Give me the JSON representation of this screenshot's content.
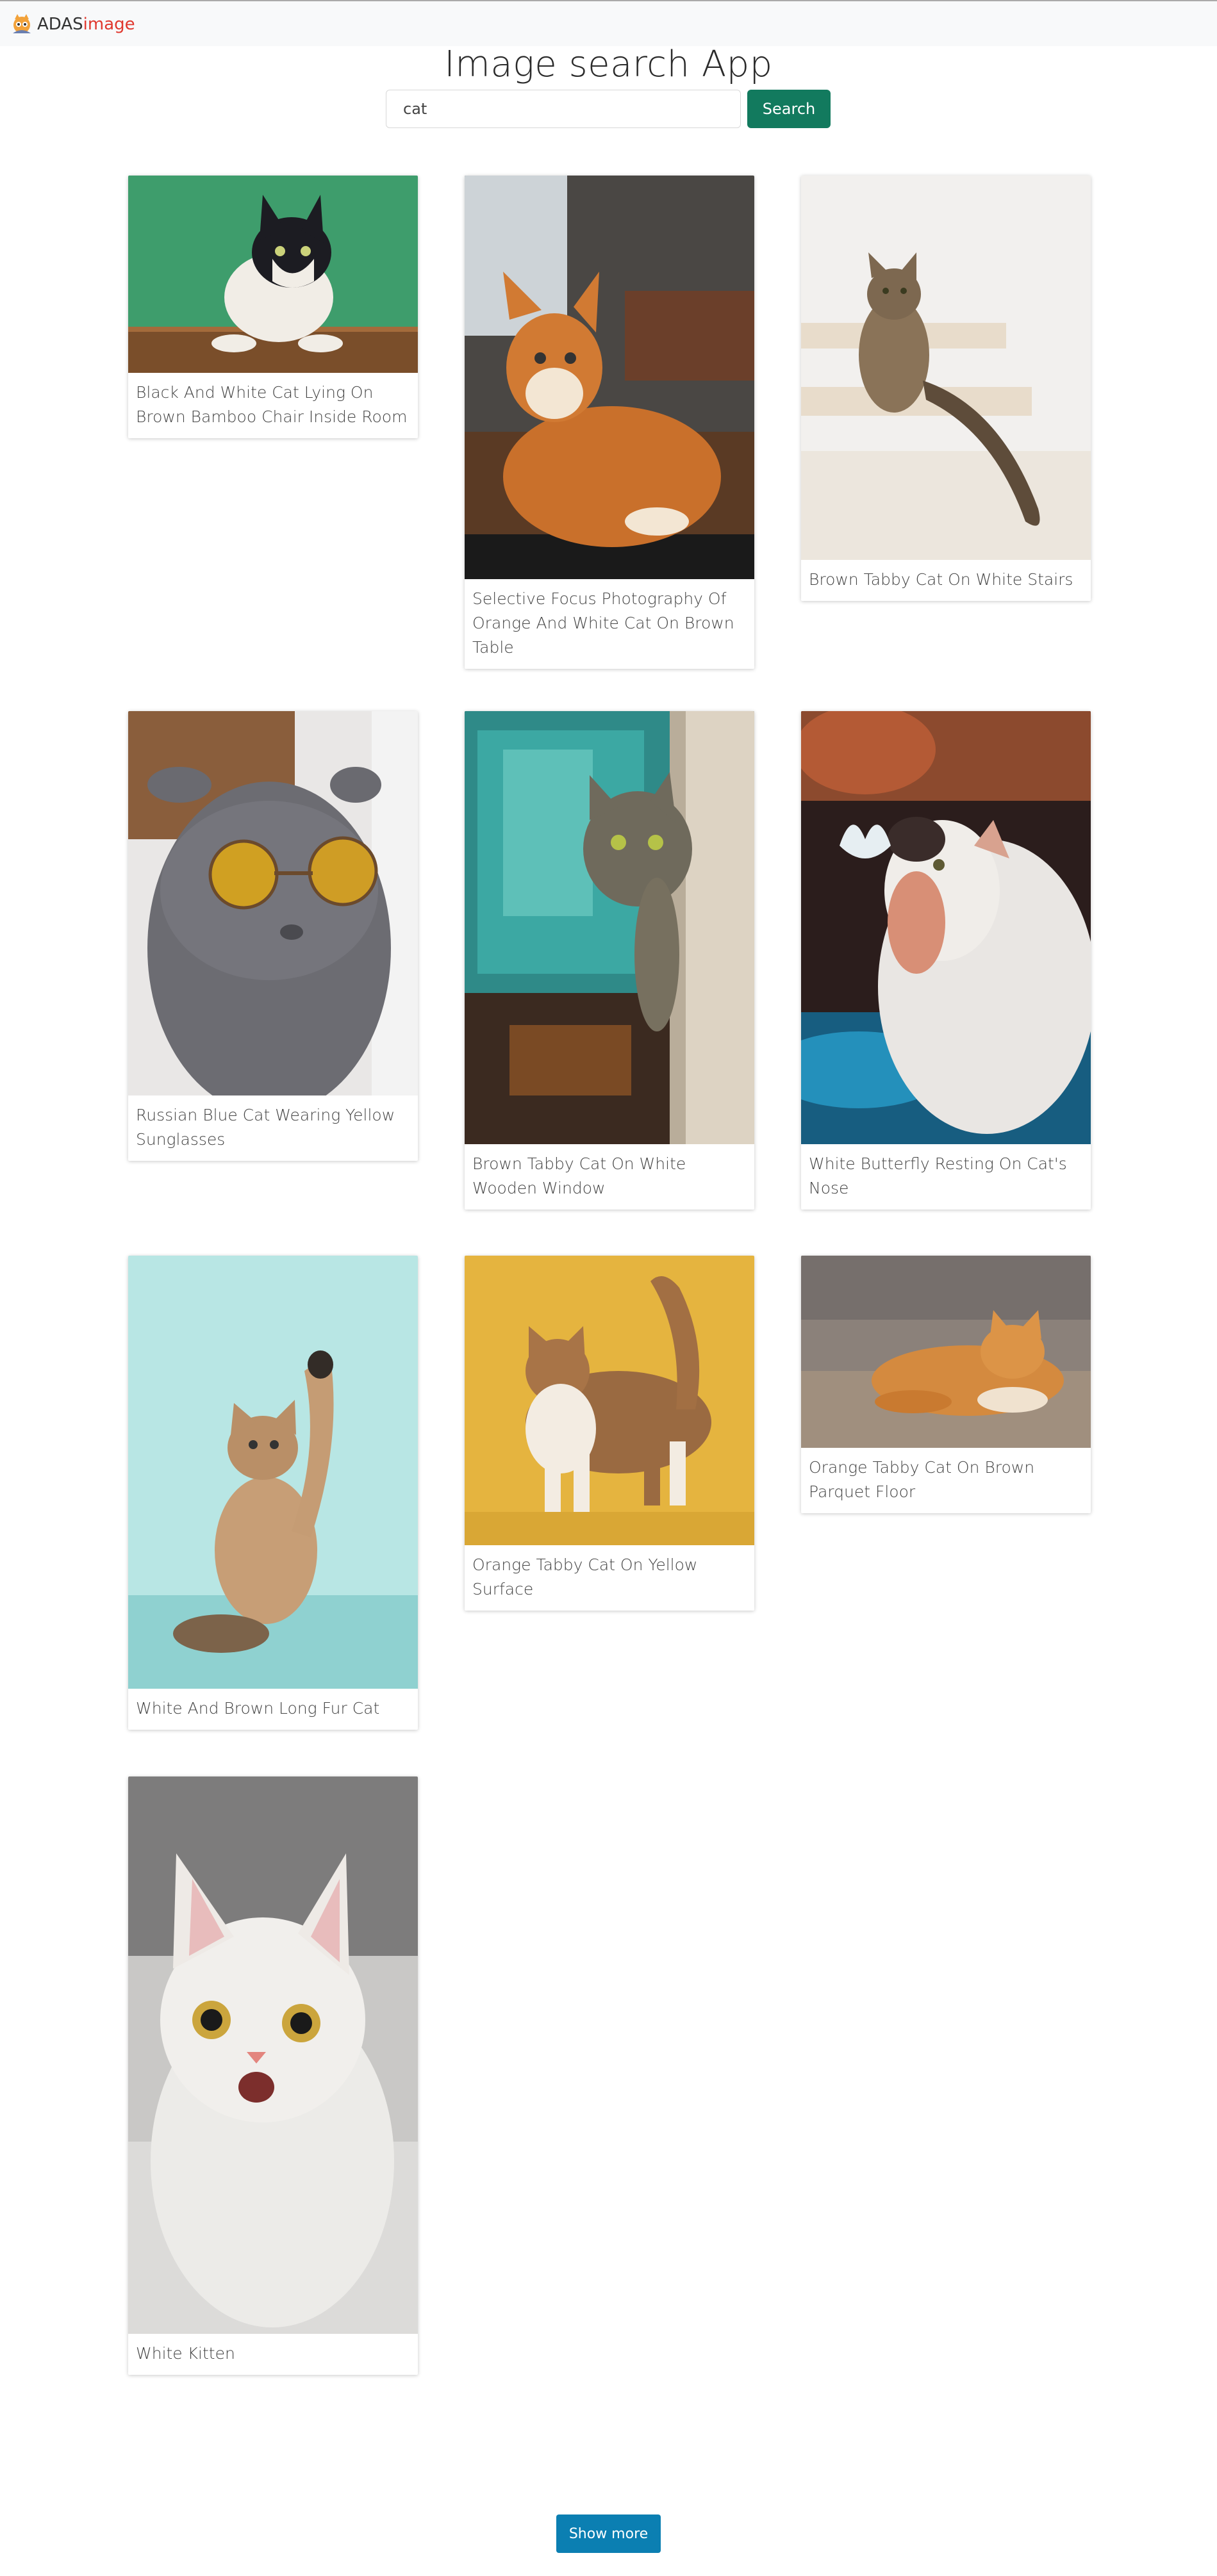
{
  "brand": {
    "prefix": "ADAS",
    "accent": "image"
  },
  "page_title": "Image search App",
  "search": {
    "value": "cat",
    "button_label": "Search"
  },
  "results": [
    {
      "caption": "Black And White Cat Lying On Brown Bamboo Chair Inside Room"
    },
    {
      "caption": "Selective Focus Photography Of Orange And White Cat On Brown Table"
    },
    {
      "caption": "Brown Tabby Cat On White Stairs"
    },
    {
      "caption": "Russian Blue Cat Wearing Yellow Sunglasses"
    },
    {
      "caption": "Brown Tabby Cat On White Wooden Window"
    },
    {
      "caption": "White Butterfly Resting On Cat's Nose"
    },
    {
      "caption": "White And Brown Long Fur Cat"
    },
    {
      "caption": "Orange Tabby Cat On Yellow Surface"
    },
    {
      "caption": "Orange Tabby Cat On Brown Parquet Floor"
    },
    {
      "caption": "White Kitten"
    }
  ],
  "show_more_label": "Show more",
  "colors": {
    "search_button": "#127a5e",
    "show_more_button": "#0b7fb2",
    "brand_accent": "#e0382e"
  }
}
